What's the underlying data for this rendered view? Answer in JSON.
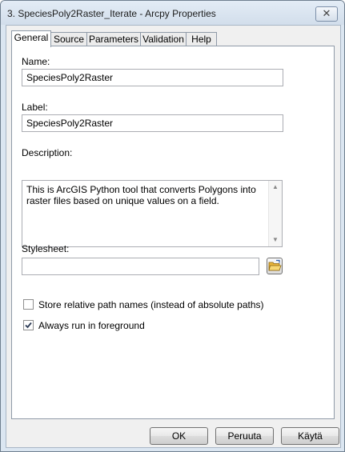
{
  "window": {
    "title": "3. SpeciesPoly2Raster_Iterate - Arcpy Properties",
    "close_glyph": "✕"
  },
  "tabs": [
    {
      "label": "General",
      "active": true
    },
    {
      "label": "Source",
      "active": false
    },
    {
      "label": "Parameters",
      "active": false
    },
    {
      "label": "Validation",
      "active": false
    },
    {
      "label": "Help",
      "active": false
    }
  ],
  "general": {
    "name_label": "Name:",
    "name_value": "SpeciesPoly2Raster",
    "label_label": "Label:",
    "label_value": "SpeciesPoly2Raster",
    "description_label": "Description:",
    "description_value": "This is ArcGIS Python tool that converts Polygons into raster files based on unique values on a field.",
    "stylesheet_label": "Stylesheet:",
    "stylesheet_value": "",
    "relative_paths": {
      "label": "Store relative path names (instead of absolute paths)",
      "checked": false
    },
    "foreground": {
      "label": "Always run in foreground",
      "checked": true
    }
  },
  "icons": {
    "browse": "folder-open-icon",
    "scroll_up": "arrow-up-icon",
    "scroll_down": "arrow-down-icon"
  },
  "buttons": {
    "ok": "OK",
    "cancel": "Peruuta",
    "apply": "Käytä"
  }
}
